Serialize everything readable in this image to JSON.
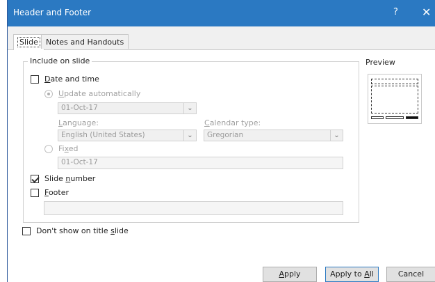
{
  "dialog": {
    "title": "Header and Footer",
    "help": "?",
    "close": "✕"
  },
  "tabs": [
    {
      "label": "Slide",
      "active": true
    },
    {
      "label": "Notes and Handouts",
      "active": false
    }
  ],
  "include": {
    "legend": "Include on slide",
    "date_time": {
      "label_pre": "",
      "accel": "D",
      "label_post": "ate and time",
      "checked": false
    },
    "update_auto": {
      "accel": "U",
      "label_post": "pdate automatically",
      "selected": true
    },
    "update_value": "01-Oct-17",
    "language": {
      "accel": "L",
      "label_post": "anguage:",
      "value": "English (United States)"
    },
    "calendar": {
      "accel": "C",
      "label_post": "alendar type:",
      "value": "Gregorian"
    },
    "fixed": {
      "label_pre": "Fi",
      "accel": "x",
      "label_post": "ed",
      "selected": false,
      "value": "01-Oct-17"
    },
    "slide_number": {
      "label_pre": "Slide ",
      "accel": "n",
      "label_post": "umber",
      "checked": true
    },
    "footer": {
      "accel": "F",
      "label_post": "ooter",
      "checked": false,
      "value": ""
    }
  },
  "dont_show": {
    "label_pre": "Don't show on title ",
    "accel": "s",
    "label_post": "lide",
    "checked": false
  },
  "preview": {
    "legend": "Preview"
  },
  "buttons": {
    "apply": {
      "accel": "A",
      "label_post": "pply"
    },
    "apply_all": {
      "label_pre": "Apply to ",
      "accel": "A",
      "label_post": "ll"
    },
    "cancel": "Cancel"
  }
}
